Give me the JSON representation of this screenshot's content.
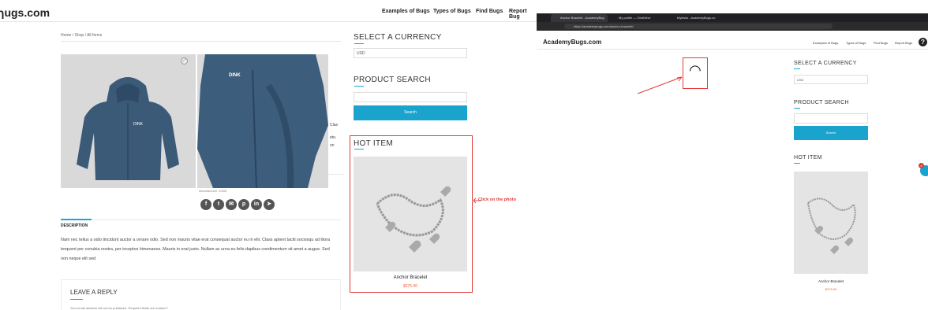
{
  "left": {
    "logo": "ɿugs.com",
    "nav": [
      "Examples of Bugs",
      "Types of Bugs",
      "Find Bugs",
      "Report Bug"
    ],
    "breadcrumb": "Home / Shop / All Items",
    "product_brand": "DINK",
    "meta_fragments": [
      "Clas",
      "eto.",
      "on"
    ],
    "manufacturer": "Manufacturer: DINK",
    "description_heading": "DESCRIPTION",
    "description": "Nam nec tellus a odio tincidunt auctor a ornare odio. Sed non mauris vitae erat consequat auctor eu in elit. Class aptent taciti sociosqu ad litora torquent per conubia nostra, per inceptos himenaeos. Mauris in erat justo. Nullam ac urna eu felis dapibus condimentum sit amet a augue. Sed non neque elit sed.",
    "reply_heading": "LEAVE A REPLY",
    "reply_note": "Your email address will not be published. Required fields are marked *",
    "sidebar": {
      "currency_heading": "SELECT A CURRENCY",
      "currency_value": "USD",
      "search_heading": "PRODUCT SEARCH",
      "search_button": "Search",
      "hot_heading": "HOT ITEM",
      "product_name": "Anchor Bracelet",
      "product_price": "$275.00"
    },
    "annotation": "Click on the photo",
    "accent_color": "#1aa3cc",
    "annotation_color": "#e23b3b"
  },
  "right": {
    "tabs": [
      "Anchor Bracelet - AcademyBug",
      "My profile — OneDrive",
      "Mytesto - AcademyBugs.co"
    ],
    "url": "https://academybugs.com/anchor-bracelet/",
    "logo": "AcademyBugs.com",
    "nav": [
      "Examples of Bugs",
      "Types of Bugs",
      "Find Bugs",
      "Report Bugs"
    ],
    "loading_char": "◠",
    "sidebar": {
      "currency_heading": "SELECT A CURRENCY",
      "currency_value": "USD",
      "search_heading": "PRODUCT SEARCH",
      "search_button": "Search",
      "hot_heading": "HOT ITEM",
      "product_name": "Anchor Bracelet",
      "product_price": "$275.00"
    },
    "badge": "4"
  }
}
